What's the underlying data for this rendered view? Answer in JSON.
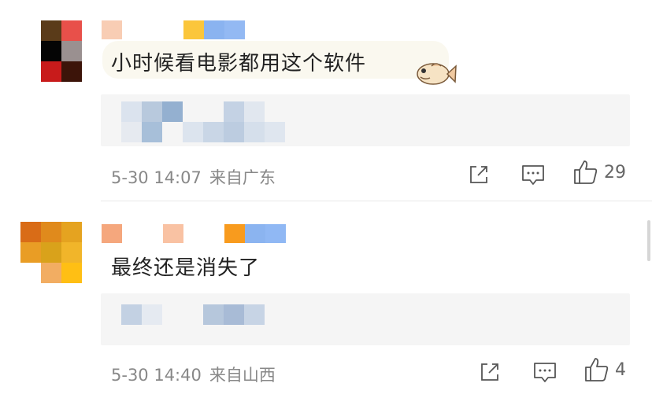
{
  "comments": [
    {
      "text": "小时候看电影都用这个软件",
      "time": "5-30 14:07",
      "location": "来自广东",
      "likes": "29",
      "sticker_icon": "fish-sticker-icon"
    },
    {
      "text": "最终还是消失了",
      "time": "5-30 14:40",
      "location": "来自山西",
      "likes": "4"
    }
  ],
  "colors": {
    "background": "#ffffff",
    "reply_background": "#f5f5f5",
    "meta_text": "#888888",
    "comment_text": "#222222"
  }
}
